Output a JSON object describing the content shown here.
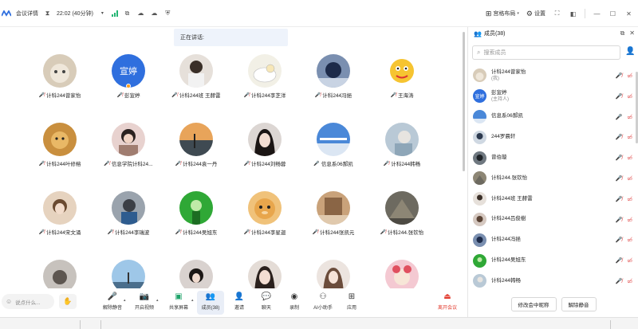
{
  "topbar": {
    "meeting_details": "会议详情",
    "time": "22:02 (40分钟)",
    "layout": "宫格布局",
    "settings": "设置"
  },
  "speaking": "正在讲话:",
  "grid": {
    "tiles": [
      {
        "name": "计科244曾家怡",
        "mic": "off"
      },
      {
        "name": "彭宣婷",
        "mic": "off",
        "text_avatar": "宣婷"
      },
      {
        "name": "计科244班 王赫雷",
        "mic": "off"
      },
      {
        "name": "计科244李芝洋",
        "mic": "off"
      },
      {
        "name": "计科244冯挹",
        "mic": "off"
      },
      {
        "name": "王海涛",
        "mic": "off"
      },
      {
        "name": "计科244叶修榕",
        "mic": "off"
      },
      {
        "name": "信息学院计科24...",
        "mic": "off"
      },
      {
        "name": "计科244袁一丹",
        "mic": "off"
      },
      {
        "name": "计科244刘畅蓉",
        "mic": "off"
      },
      {
        "name": "信息系06郝凯",
        "mic": "on"
      },
      {
        "name": "计科244韩畅",
        "mic": "off"
      },
      {
        "name": "计科244宋文涌",
        "mic": "off"
      },
      {
        "name": "计科244李瑞波",
        "mic": "off"
      },
      {
        "name": "计科244吴旭东",
        "mic": "off"
      },
      {
        "name": "计科244李星迦",
        "mic": "off"
      },
      {
        "name": "计科244张凯元",
        "mic": "off"
      },
      {
        "name": "计科244.张钦怡",
        "mic": "off"
      },
      {
        "name": "",
        "mic": "none"
      },
      {
        "name": "",
        "mic": "none"
      },
      {
        "name": "",
        "mic": "none"
      },
      {
        "name": "",
        "mic": "none"
      },
      {
        "name": "",
        "mic": "none"
      },
      {
        "name": "",
        "mic": "none"
      }
    ]
  },
  "bottombar": {
    "say_placeholder": "说点什么...",
    "tools": [
      {
        "label": "解除静音",
        "icon": "mic-off-icon"
      },
      {
        "label": "开启视频",
        "icon": "camera-off-icon"
      },
      {
        "label": "共享屏幕",
        "icon": "share-screen-icon"
      },
      {
        "label": "成员(38)",
        "icon": "members-icon"
      },
      {
        "label": "邀请",
        "icon": "invite-icon"
      },
      {
        "label": "聊天",
        "icon": "chat-icon"
      },
      {
        "label": "录制",
        "icon": "record-icon"
      },
      {
        "label": "AI小助手",
        "icon": "ai-assistant-icon"
      },
      {
        "label": "应用",
        "icon": "apps-icon"
      }
    ],
    "leave": "离开会议"
  },
  "panel": {
    "title": "成员(38)",
    "search_placeholder": "搜索成员",
    "members": [
      {
        "name": "计科244曾家怡",
        "role": "(我)",
        "mic": "off",
        "cam": "off"
      },
      {
        "name": "彭宣婷",
        "role": "(主持人)",
        "mic": "off",
        "cam": "off",
        "text_avatar": "宣婷"
      },
      {
        "name": "信息系06郝凯",
        "role": "",
        "mic": "on",
        "cam": "off"
      },
      {
        "name": "244罗晨轩",
        "role": "",
        "mic": "off",
        "cam": "off"
      },
      {
        "name": "曾伯璇",
        "role": "",
        "mic": "off",
        "cam": "off"
      },
      {
        "name": "计科244.张钦怡",
        "role": "",
        "mic": "off",
        "cam": "off"
      },
      {
        "name": "计科244班 王赫雷",
        "role": "",
        "mic": "off",
        "cam": "off"
      },
      {
        "name": "计科244吕俊樹",
        "role": "",
        "mic": "off",
        "cam": "off"
      },
      {
        "name": "计科244冯挹",
        "role": "",
        "mic": "off",
        "cam": "off"
      },
      {
        "name": "计科244吴旭东",
        "role": "",
        "mic": "off",
        "cam": "off"
      },
      {
        "name": "计科244韩畅",
        "role": "",
        "mic": "off",
        "cam": "off"
      }
    ],
    "mute_all_notice": "修改会中昵称",
    "unmute_all": "解除静音"
  },
  "colors": {
    "accent": "#2f6fde",
    "danger": "#e23b2e",
    "signal": "#22b573"
  }
}
